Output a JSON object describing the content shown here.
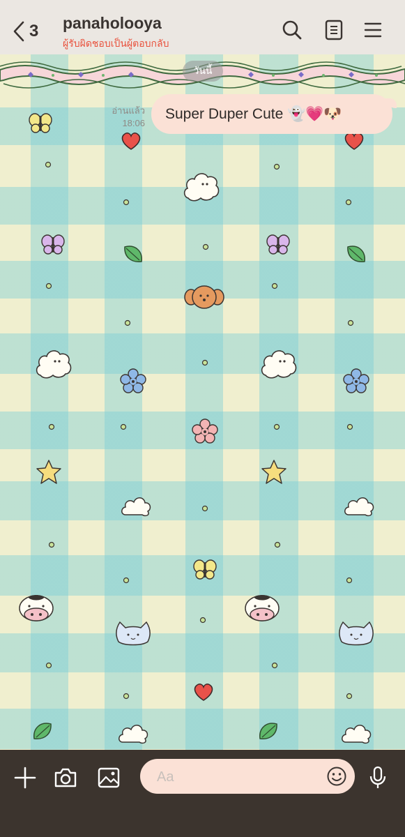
{
  "header": {
    "back_count": "3",
    "title": "panaholooya",
    "subtitle": "ผู้รับผิดชอบเป็นผู้ตอบกลับ",
    "icons": [
      "search-icon",
      "notes-icon",
      "menu-icon"
    ]
  },
  "chat": {
    "date_separator": "วันนี้",
    "messages": [
      {
        "text": "Super Duper Cute 👻💗🐶",
        "read_status": "อ่านแล้ว",
        "time": "18:06"
      }
    ]
  },
  "composer": {
    "placeholder": "Aa",
    "icons": [
      "plus-icon",
      "camera-icon",
      "image-icon",
      "emoji-icon",
      "microphone-icon"
    ]
  },
  "colors": {
    "header_bg": "#ebe7e2",
    "accent_red": "#e9523d",
    "bubble_bg": "#fbe1d6",
    "bottom_bar_bg": "#3c342e",
    "gingham_yellow": "#f0efcf",
    "gingham_teal": "#9cd9d6"
  }
}
